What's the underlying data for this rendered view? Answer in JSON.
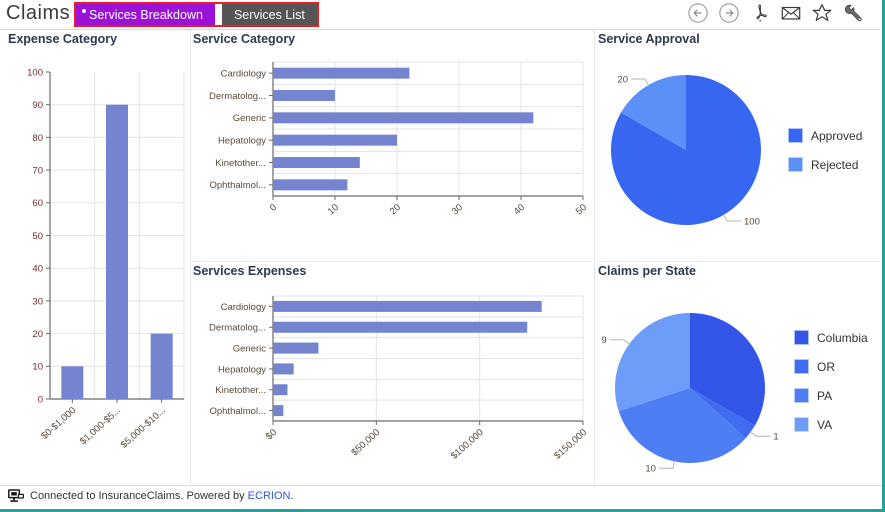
{
  "header": {
    "title": "Claims",
    "tabs": [
      {
        "label": "Services Breakdown",
        "active": true,
        "has_dot": true
      },
      {
        "label": "Services List",
        "active": false,
        "has_dot": false
      }
    ],
    "icons": [
      {
        "name": "back-arrow-icon",
        "label": "Back"
      },
      {
        "name": "forward-arrow-icon",
        "label": "Forward"
      },
      {
        "name": "pdf-icon",
        "label": "Export to PDF"
      },
      {
        "name": "email-icon",
        "label": "Send by Email"
      },
      {
        "name": "favorite-star-icon",
        "label": "Add to Favorites"
      },
      {
        "name": "wrench-settings-icon",
        "label": "Settings"
      }
    ],
    "accent_red": "#ee1c25",
    "accent_purple": "#9b11d6",
    "accent_gray": "#555555"
  },
  "panels": {
    "expense_title": "Expense Category",
    "service_category_title": "Service Category",
    "services_expenses_title": "Services Expenses",
    "service_approval_title": "Service Approval",
    "claims_per_state_title": "Claims per State"
  },
  "chart_data": [
    {
      "id": "expense-category",
      "type": "bar",
      "title": "Expense Category",
      "orientation": "vertical",
      "categories": [
        "$0-$1,000",
        "$1,000-$5...",
        "$5,000-$10..."
      ],
      "values": [
        10,
        90,
        20
      ],
      "xlabel": "",
      "ylabel": "",
      "ylim": [
        0,
        100
      ],
      "yticks": [
        0,
        10,
        20,
        30,
        40,
        50,
        60,
        70,
        80,
        90,
        100
      ],
      "grid": true,
      "legend": "none",
      "color": "#7484cf"
    },
    {
      "id": "service-category",
      "type": "bar",
      "title": "Service Category",
      "orientation": "horizontal",
      "categories": [
        "Cardiology",
        "Dermatolog...",
        "Generic",
        "Hepatology",
        "Kinetother...",
        "Ophthalmol..."
      ],
      "values": [
        22,
        10,
        42,
        20,
        14,
        12
      ],
      "xlabel": "",
      "ylabel": "",
      "xlim": [
        0,
        50
      ],
      "xticks": [
        0,
        10,
        20,
        30,
        40,
        50
      ],
      "xticklabels": [
        "0",
        "10",
        "20",
        "30",
        "40",
        "50"
      ],
      "grid": true,
      "legend": "none",
      "color": "#7484cf"
    },
    {
      "id": "services-expenses",
      "type": "bar",
      "title": "Services Expenses",
      "orientation": "horizontal",
      "categories": [
        "Cardiology",
        "Dermatolog...",
        "Generic",
        "Hepatology",
        "Kinetother...",
        "Ophthalmol..."
      ],
      "values": [
        130000,
        123000,
        22000,
        10000,
        7000,
        5000
      ],
      "xlabel": "",
      "ylabel": "",
      "xlim": [
        0,
        150000
      ],
      "xticks": [
        0,
        50000,
        100000,
        150000
      ],
      "xticklabels": [
        "$0",
        "$50,000",
        "$100,000",
        "$150,000"
      ],
      "grid": true,
      "legend": "none",
      "color": "#7484cf"
    },
    {
      "id": "service-approval",
      "type": "pie",
      "title": "Service Approval",
      "labels": [
        "Approved",
        "Rejected"
      ],
      "values": [
        100,
        20
      ],
      "value_labels": [
        "100",
        "20"
      ],
      "colors": [
        "#3767f0",
        "#5b90f6"
      ],
      "legend": "right"
    },
    {
      "id": "claims-per-state",
      "type": "pie",
      "title": "Claims per State",
      "labels": [
        "Columbia",
        "OR",
        "PA",
        "VA"
      ],
      "values": [
        10,
        1,
        10,
        9
      ],
      "value_labels": [
        "",
        "1",
        "10",
        "9"
      ],
      "colors": [
        "#3355e8",
        "#3f6cf0",
        "#4e7ef3",
        "#6d9df8"
      ],
      "legend": "right"
    }
  ],
  "statusbar": {
    "icon": "computer-monitor-icon",
    "text_before": "Connected to InsuranceClaims. Powered by ",
    "link": "ECRION",
    "text_after": "."
  }
}
